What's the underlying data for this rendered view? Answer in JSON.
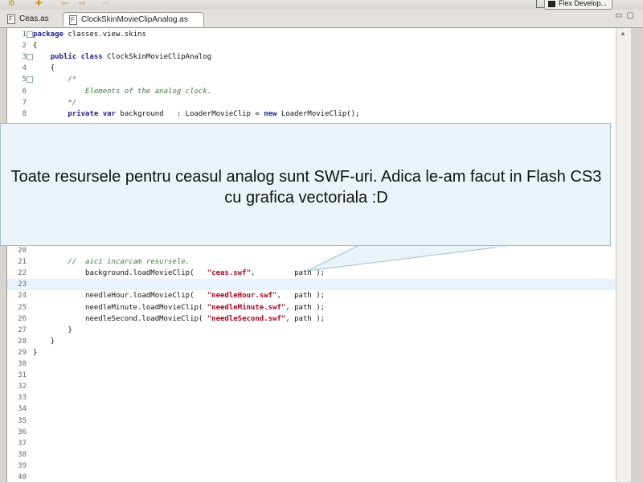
{
  "toolbar": {
    "perspective_label": "Flex Develop..."
  },
  "tabs": [
    {
      "label": "Ceas.as",
      "active": false
    },
    {
      "label": "ClockSkinMovieClipAnalog.as",
      "active": true
    }
  ],
  "tab_close_glyph": "⊠",
  "editor": {
    "lines": [
      {
        "n": "1",
        "fold": true,
        "current": false,
        "tokens": [
          [
            "kw",
            "package"
          ],
          [
            "pl",
            " classes.view.skins"
          ]
        ]
      },
      {
        "n": "2",
        "fold": false,
        "current": false,
        "tokens": [
          [
            "pl",
            "{"
          ]
        ]
      },
      {
        "n": "3",
        "fold": true,
        "current": false,
        "tokens": [
          [
            "pl",
            "    "
          ],
          [
            "kw",
            "public"
          ],
          [
            "pl",
            " "
          ],
          [
            "kw",
            "class"
          ],
          [
            "pl",
            " ClockSkinMovieClipAnalog"
          ]
        ]
      },
      {
        "n": "4",
        "fold": false,
        "current": false,
        "tokens": [
          [
            "pl",
            "    {"
          ]
        ]
      },
      {
        "n": "5",
        "fold": true,
        "current": false,
        "tokens": [
          [
            "pl",
            "        "
          ],
          [
            "cm",
            "/*"
          ]
        ]
      },
      {
        "n": "6",
        "fold": false,
        "current": false,
        "tokens": [
          [
            "pl",
            "            "
          ],
          [
            "cm",
            "Elements of the analog clock."
          ]
        ]
      },
      {
        "n": "7",
        "fold": false,
        "current": false,
        "tokens": [
          [
            "pl",
            "        "
          ],
          [
            "cm",
            "*/"
          ]
        ]
      },
      {
        "n": "8",
        "fold": false,
        "current": false,
        "tokens": [
          [
            "pl",
            "        "
          ],
          [
            "kw",
            "private"
          ],
          [
            "pl",
            " "
          ],
          [
            "kw",
            "var"
          ],
          [
            "pl",
            " background   : LoaderMovieClip = "
          ],
          [
            "kw",
            "new"
          ],
          [
            "pl",
            " LoaderMovieClip();"
          ]
        ]
      },
      {
        "n": "20",
        "fold": false,
        "current": false,
        "tokens": []
      },
      {
        "n": "21",
        "fold": false,
        "current": false,
        "tokens": [
          [
            "pl",
            "        "
          ],
          [
            "cm",
            "//  aici incarcam resursele."
          ]
        ]
      },
      {
        "n": "22",
        "fold": false,
        "current": false,
        "tokens": [
          [
            "pl",
            "            background.loadMovieClip(   "
          ],
          [
            "st",
            "\"ceas.swf\""
          ],
          [
            "pl",
            ",         path );"
          ]
        ]
      },
      {
        "n": "23",
        "fold": false,
        "current": true,
        "tokens": []
      },
      {
        "n": "24",
        "fold": false,
        "current": false,
        "tokens": [
          [
            "pl",
            "            needleHour.loadMovieClip(   "
          ],
          [
            "st",
            "\"needleHour.swf\""
          ],
          [
            "pl",
            ",   path );"
          ]
        ]
      },
      {
        "n": "25",
        "fold": false,
        "current": false,
        "tokens": [
          [
            "pl",
            "            needleMinute.loadMovieClip( "
          ],
          [
            "st",
            "\"needleMinute.swf\""
          ],
          [
            "pl",
            ", path );"
          ]
        ]
      },
      {
        "n": "26",
        "fold": false,
        "current": false,
        "tokens": [
          [
            "pl",
            "            needleSecond.loadMovieClip( "
          ],
          [
            "st",
            "\"needleSecond.swf\""
          ],
          [
            "pl",
            ", path );"
          ]
        ]
      },
      {
        "n": "27",
        "fold": false,
        "current": false,
        "tokens": [
          [
            "pl",
            "        }"
          ]
        ]
      },
      {
        "n": "28",
        "fold": false,
        "current": false,
        "tokens": [
          [
            "pl",
            "    }"
          ]
        ]
      },
      {
        "n": "29",
        "fold": false,
        "current": false,
        "tokens": [
          [
            "pl",
            "}"
          ]
        ]
      },
      {
        "n": "30",
        "fold": false,
        "current": false,
        "tokens": []
      },
      {
        "n": "31",
        "fold": false,
        "current": false,
        "tokens": []
      },
      {
        "n": "32",
        "fold": false,
        "current": false,
        "tokens": []
      },
      {
        "n": "33",
        "fold": false,
        "current": false,
        "tokens": []
      },
      {
        "n": "34",
        "fold": false,
        "current": false,
        "tokens": []
      },
      {
        "n": "35",
        "fold": false,
        "current": false,
        "tokens": []
      },
      {
        "n": "36",
        "fold": false,
        "current": false,
        "tokens": []
      },
      {
        "n": "37",
        "fold": false,
        "current": false,
        "tokens": []
      },
      {
        "n": "38",
        "fold": false,
        "current": false,
        "tokens": []
      },
      {
        "n": "39",
        "fold": false,
        "current": false,
        "tokens": []
      },
      {
        "n": "40",
        "fold": false,
        "current": false,
        "tokens": []
      }
    ]
  },
  "callout": {
    "text": "Toate resursele pentru ceasul analog sunt SWF-uri. Adica le-am facut in Flash CS3 cu grafica vectoriala :D"
  }
}
